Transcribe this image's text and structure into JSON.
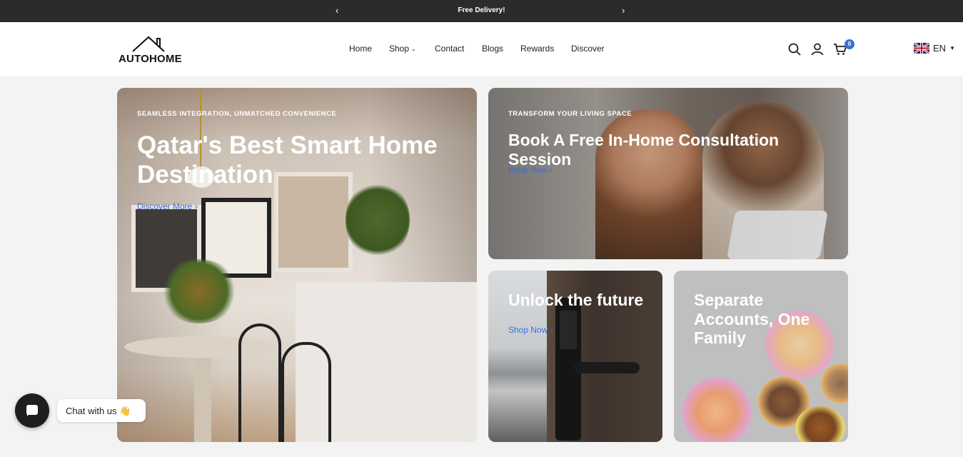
{
  "announcement": {
    "message": "Free Delivery!",
    "prev_icon": "chevron-left-icon",
    "next_icon": "chevron-right-icon"
  },
  "header": {
    "logo_text": "AUTOHOME",
    "nav": [
      {
        "label": "Home"
      },
      {
        "label": "Shop",
        "has_dropdown": true
      },
      {
        "label": "Contact"
      },
      {
        "label": "Blogs"
      },
      {
        "label": "Rewards"
      },
      {
        "label": "Discover"
      }
    ],
    "icons": [
      "search-icon",
      "account-icon",
      "cart-icon"
    ],
    "cart_count": "0",
    "language": "EN",
    "accent_color": "#3b6fd8"
  },
  "hero": {
    "eyebrow": "SEAMLESS INTEGRATION, UNMATCHED CONVENIENCE",
    "title": "Qatar's Best Smart Home Destination",
    "cta": "Discover More"
  },
  "consultation": {
    "eyebrow": "TRANSFORM YOUR LIVING SPACE",
    "title": "Book A Free In-Home Consultation Session",
    "cta": "Book Now"
  },
  "lock_card": {
    "title": "Unlock the future",
    "cta": "Shop Now"
  },
  "accounts_card": {
    "title": "Separate Accounts, One Family"
  },
  "chat": {
    "label": "Chat with us",
    "emoji": "👋"
  }
}
